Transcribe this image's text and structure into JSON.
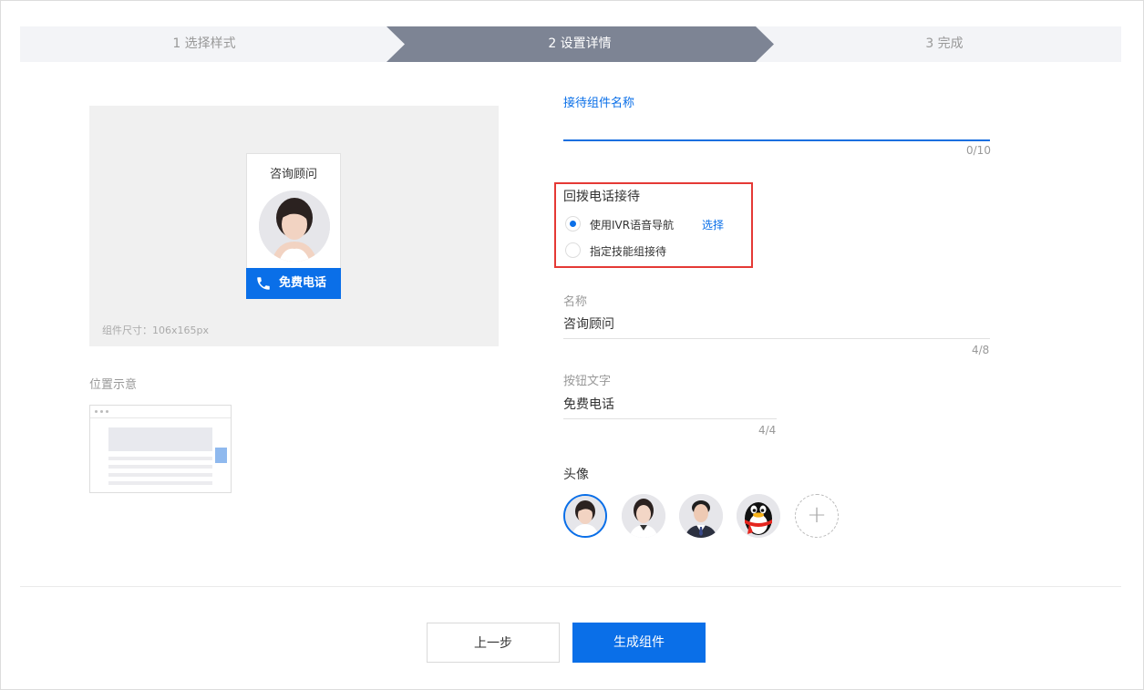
{
  "stepper": {
    "steps": [
      "1 选择样式",
      "2 设置详情",
      "3 完成"
    ],
    "active_color": "#7d8494"
  },
  "preview": {
    "card_title": "咨询顾问",
    "call_button": "免费电话",
    "size_note": "组件尺寸：106x165px",
    "accent": "#0a6fe8"
  },
  "position": {
    "label": "位置示意"
  },
  "form": {
    "widget_name": {
      "label": "接待组件名称",
      "value": "",
      "counter": "0/10"
    },
    "callback": {
      "title": "回拨电话接待",
      "options": [
        {
          "label": "使用IVR语音导航",
          "checked": true,
          "link": "选择"
        },
        {
          "label": "指定技能组接待",
          "checked": false
        }
      ]
    },
    "name": {
      "label": "名称",
      "value": "咨询顾问",
      "counter": "4/8"
    },
    "button_text": {
      "label": "按钮文字",
      "value": "免费电话",
      "counter": "4/4"
    },
    "avatar": {
      "label": "头像",
      "options": [
        "female-agent-1",
        "female-agent-2",
        "male-agent",
        "qq-penguin"
      ],
      "add_icon": "plus-icon"
    }
  },
  "footer": {
    "prev_label": "上一步",
    "generate_label": "生成组件"
  }
}
